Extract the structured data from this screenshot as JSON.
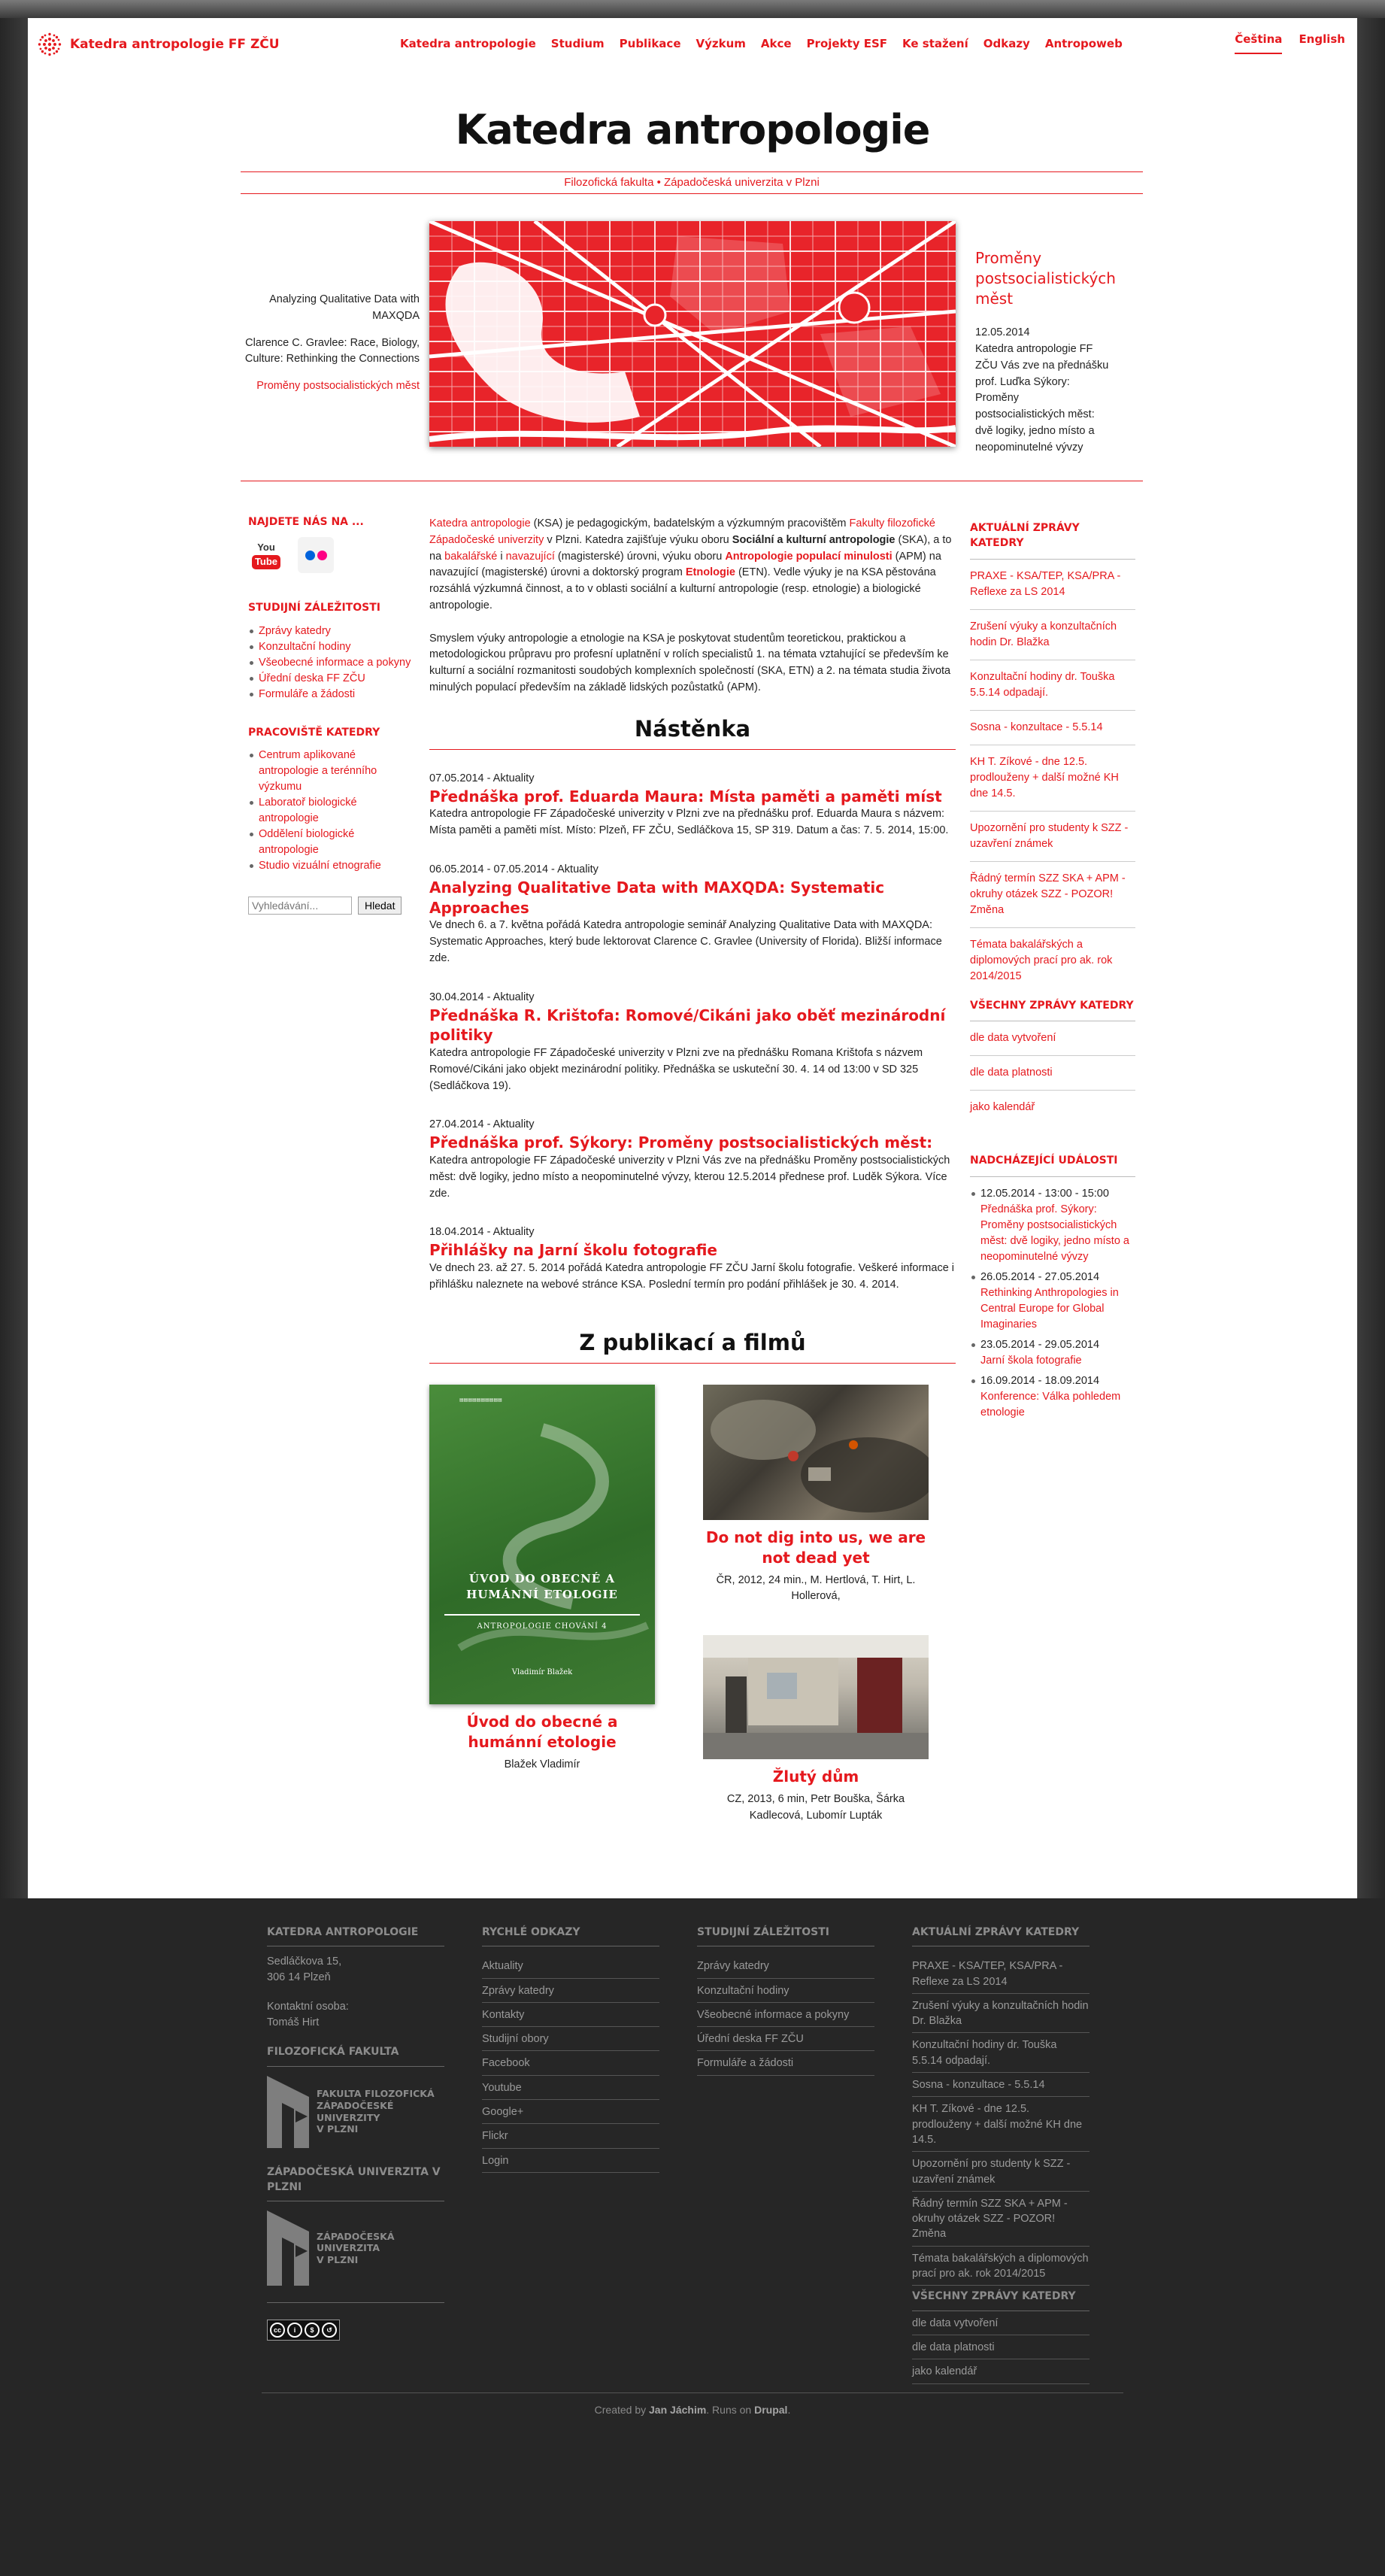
{
  "header": {
    "site_name": "Katedra antropologie FF ZČU",
    "nav": [
      "Katedra antropologie",
      "Studium",
      "Publikace",
      "Výzkum",
      "Akce",
      "Projekty ESF",
      "Ke stažení",
      "Odkazy",
      "Antropoweb"
    ],
    "lang": [
      "Čeština",
      "English"
    ]
  },
  "page_title": "Katedra antropologie",
  "subbar": {
    "part1": "Filozofická fakulta",
    "sep": " • ",
    "part2": "Západočeská univerzita v Plzni"
  },
  "slider": {
    "links": [
      "Analyzing Qualitative Data with MAXQDA",
      "Clarence C. Gravlee: Race, Biology, Culture: Rethinking the Connections",
      "Proměny postsocialistických měst"
    ],
    "title": "Proměny postsocialistických měst",
    "date": "12.05.2014",
    "text": "Katedra antropologie FF ZČU Vás zve na přednášku prof. Luďka Sýkory: Proměny postsocialistických měst: dvě logiky, jedno místo a neopominutelné vývzy"
  },
  "left": {
    "find_us": "Najdete nás na ...",
    "youtube_you": "You",
    "youtube_tube": "Tube",
    "study_heading": "Studijní záležitosti",
    "study_links": [
      "Zprávy katedry",
      "Konzultační hodiny",
      "Všeobecné informace a pokyny",
      "Úřední deska FF ZČU",
      "Formuláře a žádosti"
    ],
    "workplaces_heading": "Pracoviště katedry",
    "workplaces": [
      "Centrum aplikované antropologie a terénního výzkumu",
      "Laboratoř biologické antropologie",
      "Oddělení biologické antropologie",
      "Studio vizuální etnografie"
    ],
    "search_placeholder": "Vyhledávání...",
    "search_button": "Hledat"
  },
  "intro": {
    "p1_a": "Katedra antropologie",
    "p1_b": " (KSA) je pedagogickým, badatelským a výzkumným pracovištěm ",
    "p1_c": "Fakulty filozofické Západočeské univerzity",
    "p1_d": " v Plzni. Katedra zajišťuje výuku oboru ",
    "p1_e": "Sociální a kulturní antropologie",
    "p1_f": " (SKA), a to na ",
    "p1_g": "bakalářské",
    "p1_h": " i ",
    "p1_i": "navazující",
    "p1_j": " (magisterské) úrovni, výuku oboru ",
    "p1_k": "Antropologie populací minulosti",
    "p1_l": " (APM) na navazující (magisterské) úrovni a doktorský program ",
    "p1_m": "Etnologie",
    "p1_n": " (ETN). Vedle výuky je na KSA pěstována rozsáhlá výzkumná činnost, a to v oblasti sociální a kulturní antropologie (resp. etnologie) a biologické antropologie.",
    "p2": "Smyslem výuky antropologie a etnologie na KSA je poskytovat studentům teoretickou, praktickou a metodologickou průpravu pro profesní uplatnění v rolích specialistů 1. na témata vztahující se především ke kulturní a sociální rozmanitosti soudobých komplexních společností (SKA, ETN) a 2. na témata studia života minulých populací především na základě lidských pozůstatků (APM)."
  },
  "board_heading": "Nástěnka",
  "news": [
    {
      "meta": "07.05.2014 - Aktuality",
      "title": "Přednáška prof. Eduarda Maura: Místa paměti a paměti míst",
      "body": "Katedra antropologie FF Západočeské univerzity v Plzni zve na přednášku prof. Eduarda Maura s názvem: Místa paměti a paměti míst. Místo: Plzeň, FF ZČU, Sedláčkova 15, SP 319. Datum a čas: 7. 5. 2014, 15:00."
    },
    {
      "meta": "06.05.2014 - 07.05.2014 - Aktuality",
      "title": "Analyzing Qualitative Data with MAXQDA: Systematic Approaches",
      "body": "Ve dnech 6. a 7. května pořádá Katedra antropologie seminář Analyzing Qualitative Data with MAXQDA: Systematic Approaches, který bude lektorovat Clarence C. Gravlee (University of Florida). Bližší informace zde."
    },
    {
      "meta": "30.04.2014 - Aktuality",
      "title": "Přednáška R. Krištofa: Romové/Cikáni jako oběť mezinárodní politiky",
      "body": "Katedra antropologie FF Západočeské univerzity v Plzni zve na přednášku Romana Krištofa s názvem Romové/Cikáni jako objekt mezinárodní politiky. Přednáška se uskuteční 30. 4. 14 od 13:00 v SD 325 (Sedláčkova 19)."
    },
    {
      "meta": "27.04.2014 - Aktuality",
      "title": "Přednáška prof. Sýkory: Proměny postsocialistických měst:",
      "body": "Katedra antropologie FF Západočeské univerzity v Plzni Vás zve na přednášku Proměny postsocialistických měst: dvě logiky, jedno místo a neopominutelné vývzy, kterou 12.5.2014 přednese prof. Luděk Sýkora. Více zde."
    },
    {
      "meta": "18.04.2014 - Aktuality",
      "title": "Přihlášky na Jarní školu fotografie",
      "body": "Ve dnech 23. až 27. 5. 2014 pořádá Katedra antropologie FF ZČU Jarní školu fotografie. Veškeré informace i přihlášku naleznete na webové stránce KSA. Poslední termín pro podání přihlášek je 30. 4. 2014."
    }
  ],
  "pubs_heading": "Z publikací a filmů",
  "pubs": [
    {
      "title": "Úvod do obecné a humánní etologie",
      "sub": "Blažek Vladimír"
    },
    {
      "title": "Do not dig into us, we are not dead yet",
      "sub": "ČR, 2012, 24 min., M. Hertlová, T. Hirt, L. Hollerová,"
    },
    {
      "title": "Žlutý dům",
      "sub": "CZ, 2013, 6 min, Petr Bouška, Šárka Kadlecová, Lubomír Lupták"
    }
  ],
  "book": {
    "title": "ÚVOD DO OBECNÉ A HUMÁNNÍ ETOLOGIE",
    "series": "ANTROPOLOGIE CHOVÁNÍ 4",
    "author": "Vladimír Blažek"
  },
  "right": {
    "news_heading": "Aktuální zprávy katedry",
    "news_links": [
      "PRAXE - KSA/TEP, KSA/PRA - Reflexe za LS 2014",
      "Zrušení výuky a konzultačních hodin Dr. Blažka",
      "Konzultační hodiny dr. Touška 5.5.14 odpadají.",
      "Sosna - konzultace - 5.5.14",
      "KH T. Zíkové - dne 12.5. prodlouženy + další možné KH dne 14.5.",
      "Upozornění pro studenty k SZZ - uzavření známek",
      "Řádný termín SZZ SKA + APM - okruhy otázek SZZ - POZOR! Změna",
      "Témata bakalářských a diplomových prací pro ak. rok 2014/2015"
    ],
    "all_heading": "Všechny zprávy katedry",
    "all_links": [
      "dle data vytvoření",
      "dle data platnosti",
      "jako kalendář"
    ],
    "events_heading": "Nadcházející události",
    "events": [
      {
        "date": "12.05.2014 - 13:00 - 15:00",
        "title": "Přednáška prof. Sýkory: Proměny postsocialistických měst: dvě logiky, jedno místo a neopominutelné vývzy"
      },
      {
        "date": "26.05.2014  - 27.05.2014",
        "title": "Rethinking Anthropologies in Central Europe for Global Imaginaries"
      },
      {
        "date": "23.05.2014  - 29.05.2014",
        "title": "Jarní škola fotografie"
      },
      {
        "date": "16.09.2014  - 18.09.2014",
        "title": "Konference: Válka pohledem etnologie"
      }
    ]
  },
  "footer": {
    "col1_heading": "Katedra antropologie",
    "address1": "Sedláčkova 15,",
    "address2": "306 14 Plzeň",
    "contact_label": "Kontaktní osoba:",
    "contact_name": "Tomáš Hirt",
    "ff_heading": "Filozofická fakulta",
    "ff_logo_lines": [
      "Fakulta filozofická",
      "Západočeské",
      "univerzity",
      "v Plzni"
    ],
    "zcu_heading": "Západočeská univerzita v Plzni",
    "zcu_logo_lines": [
      "Západočeská",
      "univerzita",
      "v Plzni"
    ],
    "col2_heading": "Rychlé odkazy",
    "quick_links": [
      "Aktuality",
      "Zprávy katedry",
      "Kontakty",
      "Studijní obory",
      "Facebook",
      "Youtube",
      "Google+",
      "Flickr",
      "Login"
    ],
    "col3_heading": "Studijní záležitosti",
    "study_links": [
      "Zprávy katedry",
      "Konzultační hodiny",
      "Všeobecné informace a pokyny",
      "Úřední deska FF ZČU",
      "Formuláře a žádosti"
    ],
    "col4_heading": "Aktuální zprávy katedry",
    "news_links": [
      "PRAXE - KSA/TEP, KSA/PRA - Reflexe za LS 2014",
      "Zrušení výuky a konzultačních hodin Dr. Blažka",
      "Konzultační hodiny dr. Touška 5.5.14 odpadají.",
      "Sosna - konzultace - 5.5.14",
      "KH T. Zíkové - dne 12.5. prodlouženy + další možné KH dne 14.5.",
      "Upozornění pro studenty k SZZ - uzavření známek",
      "Řádný termín SZZ SKA + APM - okruhy otázek SZZ - POZOR! Změna",
      "Témata bakalářských a diplomových prací pro ak. rok 2014/2015"
    ],
    "all_heading": "Všechny zprávy katedry",
    "all_links": [
      "dle data vytvoření",
      "dle data platnosti",
      "jako kalendář"
    ],
    "credit_a": "Created by ",
    "credit_b": "Jan Jáchim",
    "credit_c": ". Runs on ",
    "credit_d": "Drupal",
    "credit_e": "."
  },
  "colors": {
    "accent": "#e5191e",
    "footer_bg": "#262626"
  }
}
